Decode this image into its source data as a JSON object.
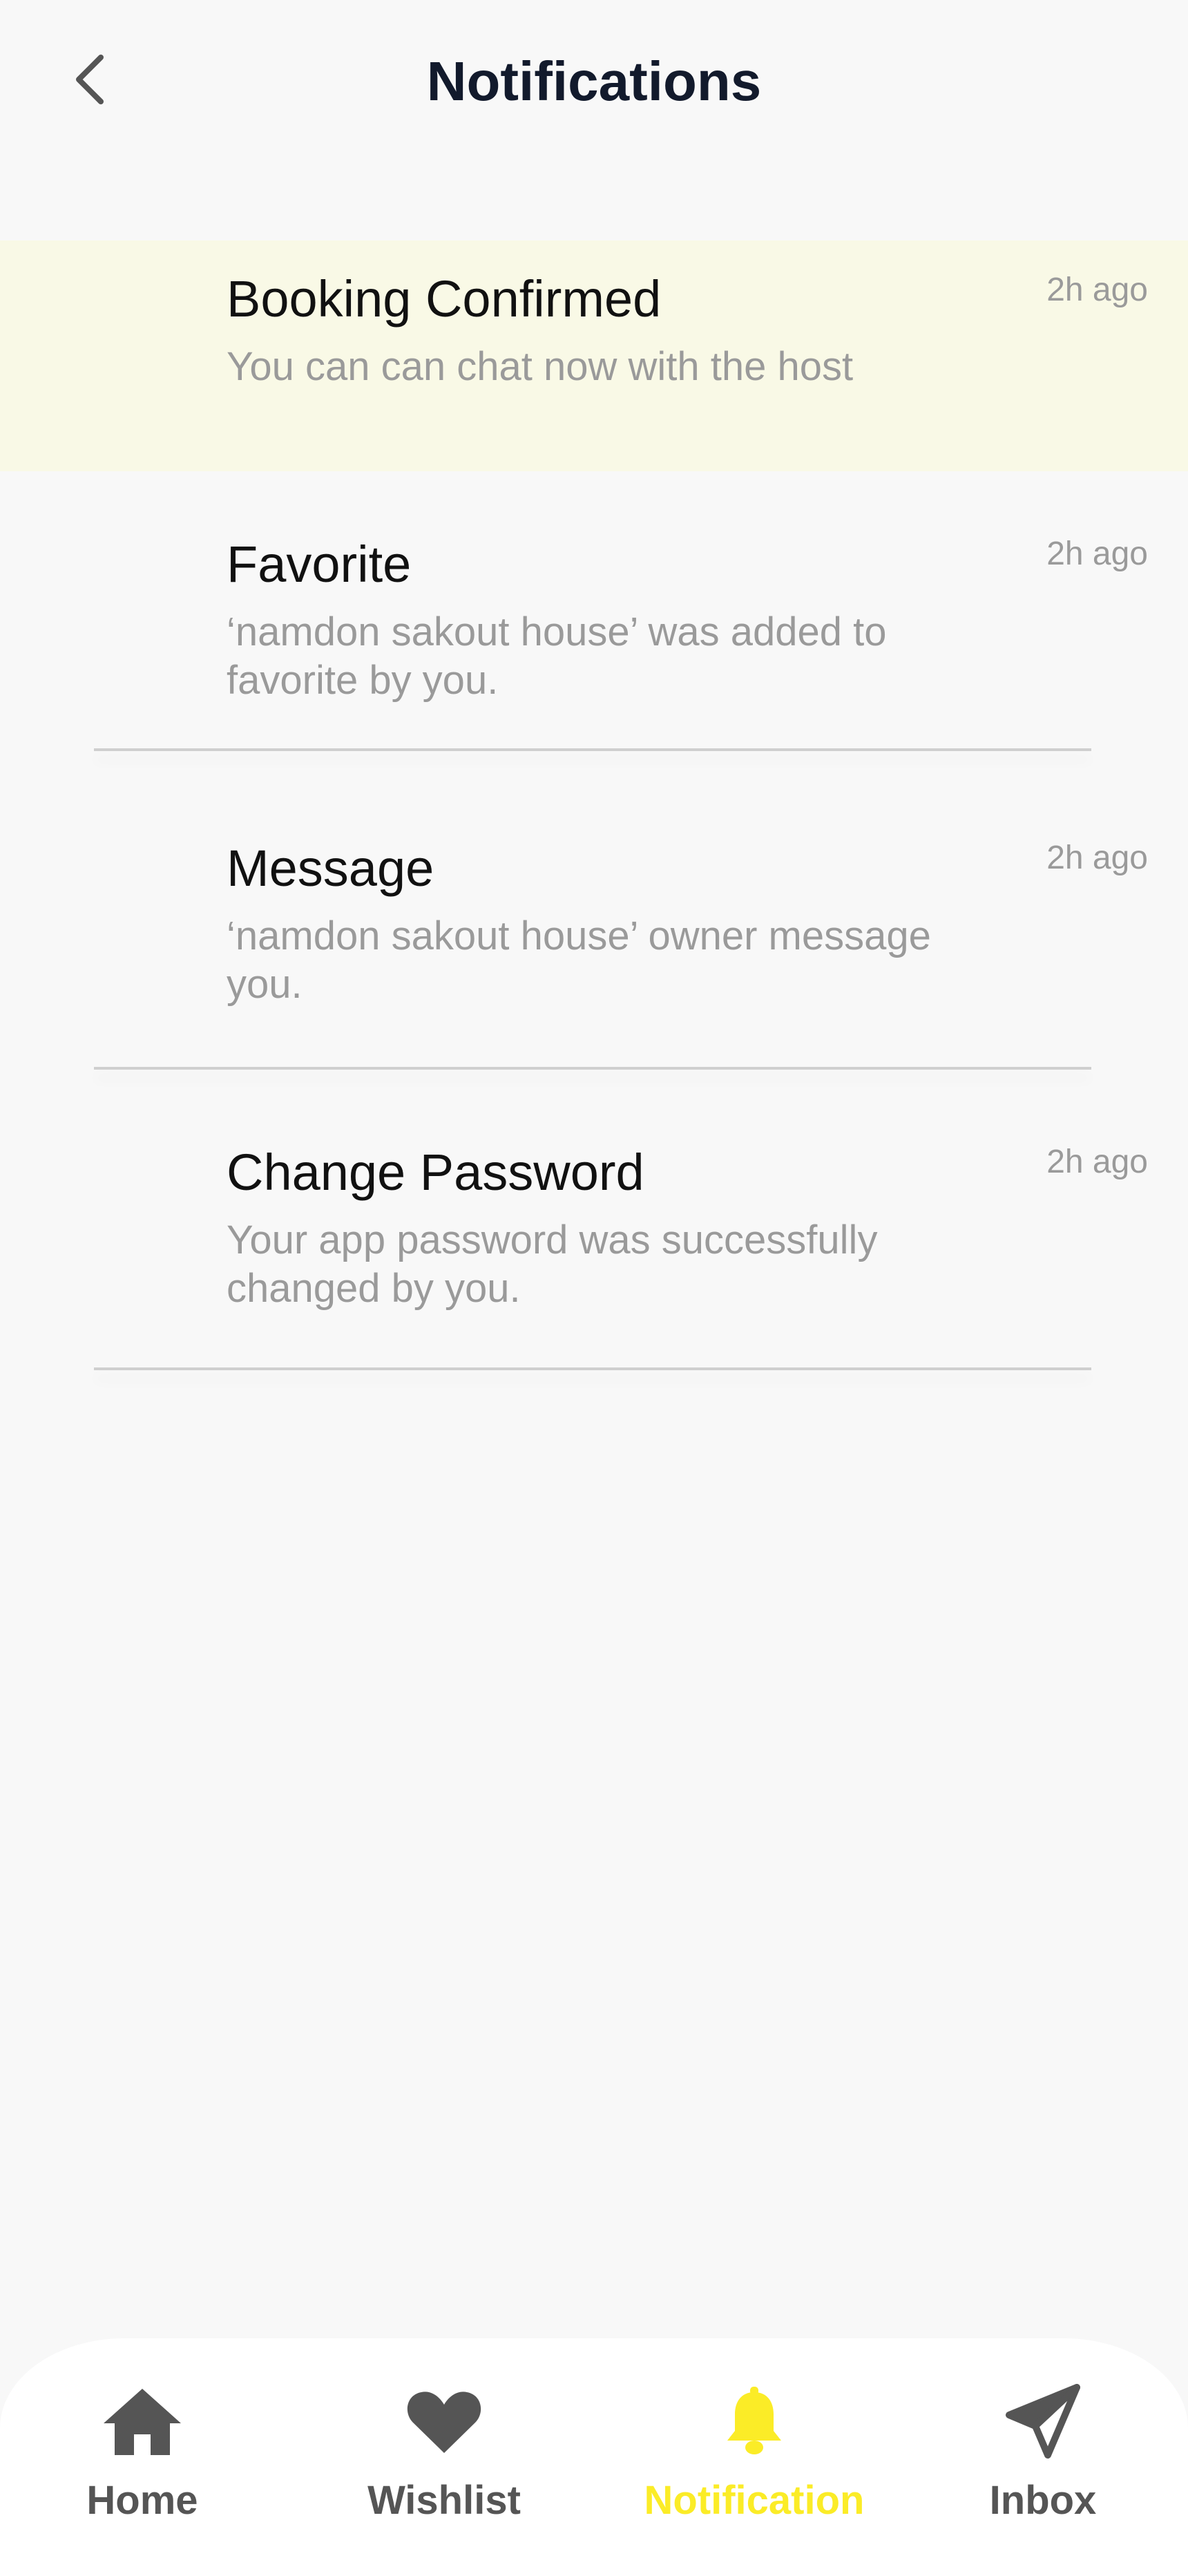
{
  "header": {
    "title": "Notifications",
    "back_icon": "chevron-left-icon"
  },
  "notifications": [
    {
      "title": "Booking Confirmed",
      "body": "You can can chat now with the host",
      "time": "2h ago",
      "highlighted": true
    },
    {
      "title": "Favorite",
      "body": "‘namdon sakout house’ was added to favorite by you.",
      "time": "2h ago",
      "highlighted": false
    },
    {
      "title": "Message",
      "body": "‘namdon sakout house’ owner message you.",
      "time": "2h ago",
      "highlighted": false
    },
    {
      "title": "Change Password",
      "body": "Your app password was successfully changed by you.",
      "time": "2h ago",
      "highlighted": false
    }
  ],
  "bottom_nav": {
    "items": [
      {
        "label": "Home",
        "icon": "home-icon",
        "active": false
      },
      {
        "label": "Wishlist",
        "icon": "heart-icon",
        "active": false
      },
      {
        "label": "Notification",
        "icon": "bell-icon",
        "active": true
      },
      {
        "label": "Inbox",
        "icon": "send-icon",
        "active": false
      }
    ]
  },
  "colors": {
    "background": "#f8f8f8",
    "highlight": "#f9f9e6",
    "accent": "#fbec27",
    "title_text": "#121a2c",
    "muted_text": "#9a9a9a",
    "icon_gray": "#555555"
  }
}
